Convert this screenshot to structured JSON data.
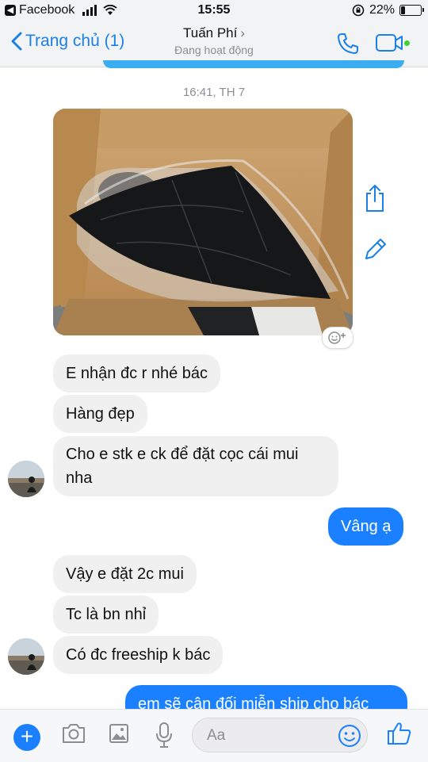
{
  "status_bar": {
    "back_app": "Facebook",
    "time": "15:55",
    "battery": "22%",
    "battery_level": 0.22
  },
  "nav": {
    "back_label": "Trang chủ (1)",
    "contact_name": "Tuấn Phí",
    "contact_status": "Đang hoạt động",
    "accent_color": "#1a80e8",
    "active_color": "#44d12f"
  },
  "conversation": {
    "timestamp": "16:41, TH 7",
    "photo_alt": "",
    "messages": [
      {
        "from": "them",
        "text": "E nhận đc r nhé bác"
      },
      {
        "from": "them",
        "text": "Hàng đẹp"
      },
      {
        "from": "them",
        "text": "Cho e stk e ck để đặt cọc cái mui nha"
      },
      {
        "from": "me",
        "text": "Vâng ạ"
      },
      {
        "from": "them",
        "text": "Vậy e đặt 2c mui"
      },
      {
        "from": "them",
        "text": "Tc là bn nhỉ"
      },
      {
        "from": "them",
        "text": "Có đc freeship k bác"
      },
      {
        "from": "me",
        "text": "em sẽ cân đối miễn ship cho bác"
      }
    ],
    "outgoing_color": "#1a80ff",
    "incoming_color": "#f0f0f0"
  },
  "composer": {
    "placeholder": "Aa"
  }
}
